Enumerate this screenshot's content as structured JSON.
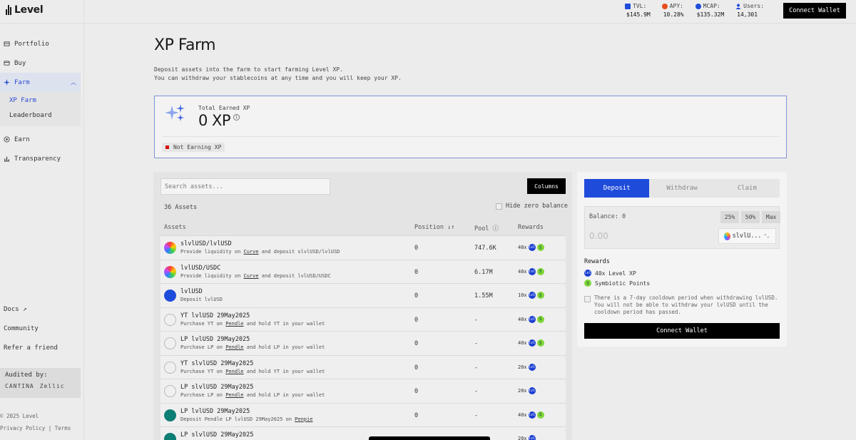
{
  "app": {
    "name": "Level"
  },
  "stats": [
    {
      "label": "TVL:",
      "value": "$145.9M",
      "color": "#1f4bdb",
      "icon": "level-icon"
    },
    {
      "label": "APY:",
      "value": "10.28%",
      "color": "#e84c1e",
      "icon": "apy-icon"
    },
    {
      "label": "MCAP:",
      "value": "$135.32M",
      "color": "#1f4bdb",
      "icon": "dollar-icon"
    },
    {
      "label": "Users:",
      "value": "14,301",
      "color": "#1f4bdb",
      "icon": "user-icon"
    }
  ],
  "header": {
    "connect_label": "Connect Wallet"
  },
  "sidebar": {
    "items": [
      {
        "label": "Portfolio",
        "icon": "portfolio-icon"
      },
      {
        "label": "Buy",
        "icon": "buy-icon"
      },
      {
        "label": "Farm",
        "icon": "sparkle-icon"
      },
      {
        "label": "Earn",
        "icon": "earn-icon"
      },
      {
        "label": "Transparency",
        "icon": "chart-icon"
      }
    ],
    "farm_sub": [
      {
        "label": "XP Farm"
      },
      {
        "label": "Leaderboard"
      }
    ],
    "links": [
      {
        "label": "Docs ↗"
      },
      {
        "label": "Community"
      },
      {
        "label": "Refer a friend"
      }
    ],
    "audited": {
      "title": "Audited by:",
      "auditors": [
        "CANTINA",
        "Zellic"
      ]
    },
    "copyright": "© 2025 Level",
    "legal": "Privacy Policy | Terms"
  },
  "main": {
    "title": "XP Farm",
    "desc1": "Deposit assets into the farm to start farming Level XP.",
    "desc2": "You can withdraw your stablecoins at any time and you will keep your XP.",
    "xp_card": {
      "label": "Total Earned XP",
      "value": "0 XP",
      "status": "Not Earning XP",
      "status_color": "#d31212"
    }
  },
  "assets": {
    "search_placeholder": "Search assets...",
    "columns_label": "Columns",
    "count": "36 Assets",
    "hide_zero_label": "Hide zero balance",
    "headers": {
      "asset": "Assets",
      "position": "Position",
      "pool": "Pool",
      "rewards": "Rewards"
    },
    "rows": [
      {
        "name": "slvlUSD/lvlUSD",
        "pre": "Provide liquidity on ",
        "link": "Curve",
        "post": " and deposit slvlUSD/lvlUSD",
        "position": "0",
        "pool": "747.6K",
        "mult": "40x",
        "symbiotic": true,
        "icon": "curve"
      },
      {
        "name": "lvlUSD/USDC",
        "pre": "Provide liquidity on ",
        "link": "Curve",
        "post": " and deposit lvlUSD/USDC",
        "position": "0",
        "pool": "6.17M",
        "mult": "40x",
        "symbiotic": true,
        "icon": "curve"
      },
      {
        "name": "lvlUSD",
        "pre": "Deposit lvlUSD",
        "link": "",
        "post": "",
        "position": "0",
        "pool": "1.55M",
        "mult": "10x",
        "symbiotic": true,
        "icon": "lvlusd"
      },
      {
        "name": "YT lvlUSD 29May2025",
        "pre": "Purchase YT on ",
        "link": "Pendle",
        "post": " and hold YT in your wallet",
        "position": "0",
        "pool": "-",
        "mult": "40x",
        "symbiotic": true,
        "icon": "pendle"
      },
      {
        "name": "LP lvlUSD 29May2025",
        "pre": "Purchase LP on ",
        "link": "Pendle",
        "post": " and hold LP in your wallet",
        "position": "0",
        "pool": "-",
        "mult": "40x",
        "symbiotic": true,
        "icon": "pendle"
      },
      {
        "name": "YT slvlUSD 29May2025",
        "pre": "Purchase YT on ",
        "link": "Pendle",
        "post": " and hold YT in your wallet",
        "position": "0",
        "pool": "-",
        "mult": "20x",
        "symbiotic": false,
        "icon": "pendle"
      },
      {
        "name": "LP slvlUSD 29May2025",
        "pre": "Purchase LP on ",
        "link": "Pendle",
        "post": " and hold LP in your wallet",
        "position": "0",
        "pool": "-",
        "mult": "20x",
        "symbiotic": false,
        "icon": "pendle"
      },
      {
        "name": "LP lvlUSD 29May2025",
        "pre": "Deposit Pendle LP lvlUSD 29May2025 on ",
        "link": "Penpie",
        "post": "",
        "position": "0",
        "pool": "-",
        "mult": "40x",
        "symbiotic": true,
        "icon": "penpie"
      },
      {
        "name": "LP slvlUSD 29May2025",
        "pre": "",
        "link": "",
        "post": "",
        "position": "",
        "pool": "",
        "mult": "20x",
        "symbiotic": false,
        "icon": "penpie"
      }
    ]
  },
  "deposit": {
    "tabs": [
      "Deposit",
      "Withdraw",
      "Claim"
    ],
    "balance_label": "Balance: 0",
    "pcts": [
      "25%",
      "50%",
      "Max"
    ],
    "amount_placeholder": "0.00",
    "token": "slvlU...",
    "rewards_title": "Rewards",
    "reward1": "40x Level XP",
    "reward2": "Symbiotic Points",
    "cooldown": "There is a 7-day cooldown period when withdrawing lvlUSD. You will not be able to withdraw your lvlUSD until the cooldown period has passed.",
    "connect_label": "Connect Wallet"
  }
}
